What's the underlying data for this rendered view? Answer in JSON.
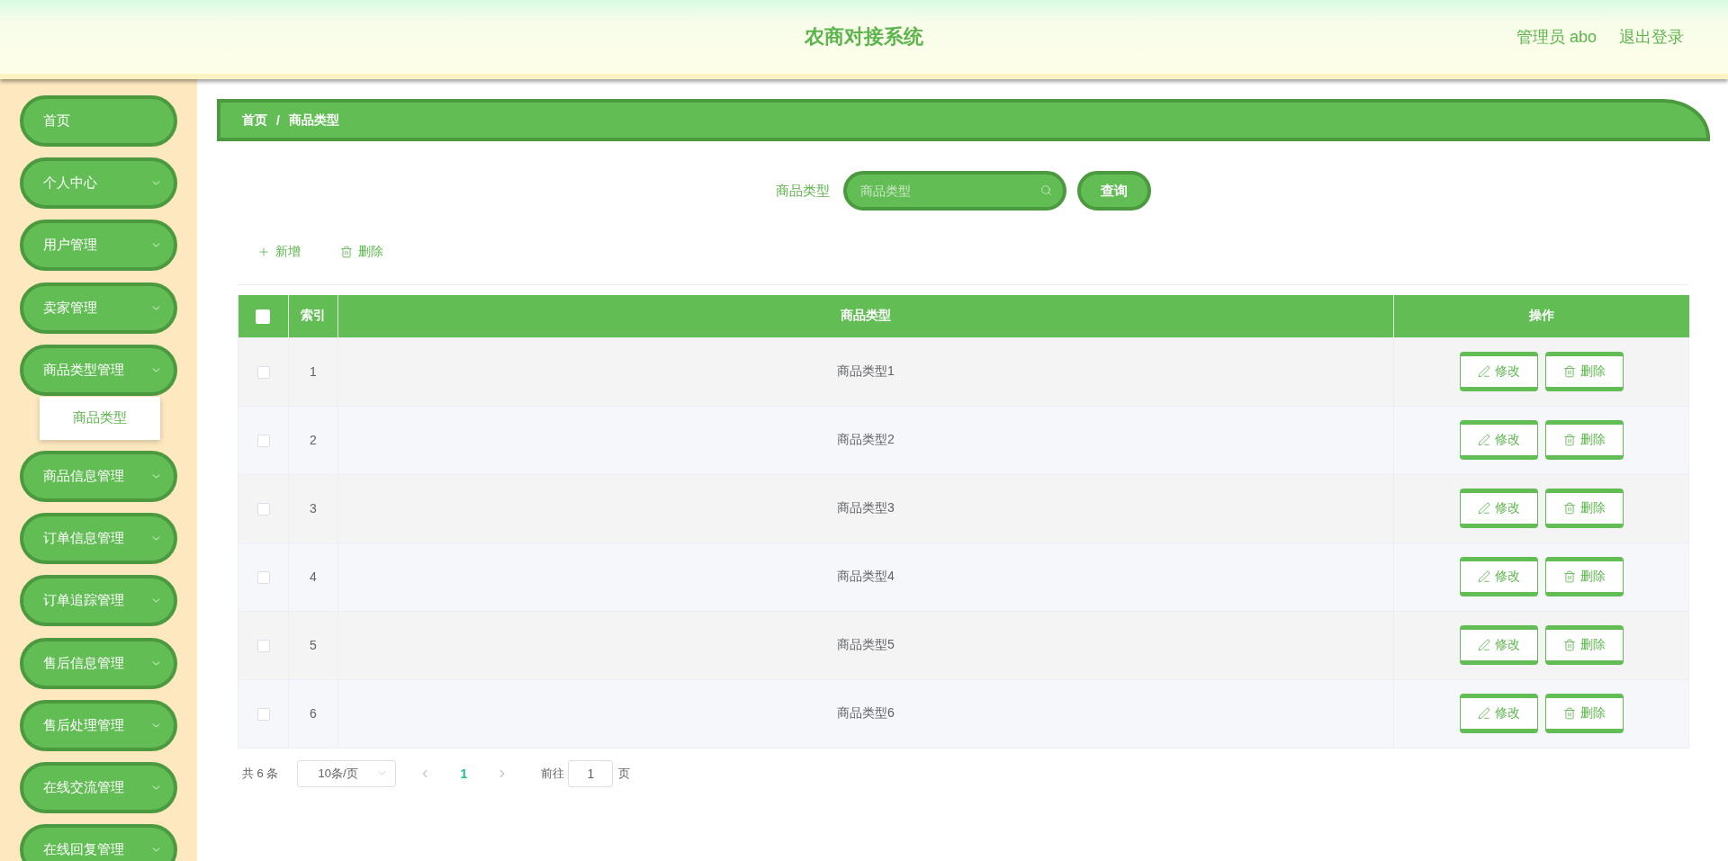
{
  "header": {
    "title": "农商对接系统",
    "user": "管理员 abo",
    "logout": "退出登录"
  },
  "sidebar": {
    "items": [
      {
        "kind": "link",
        "label": "首页"
      },
      {
        "kind": "submenu",
        "label": "个人中心"
      },
      {
        "kind": "submenu",
        "label": "用户管理"
      },
      {
        "kind": "submenu",
        "label": "卖家管理"
      },
      {
        "kind": "submenu",
        "label": "商品类型管理",
        "children": [
          {
            "label": "商品类型"
          }
        ]
      },
      {
        "kind": "submenu",
        "label": "商品信息管理"
      },
      {
        "kind": "submenu",
        "label": "订单信息管理"
      },
      {
        "kind": "submenu",
        "label": "订单追踪管理"
      },
      {
        "kind": "submenu",
        "label": "售后信息管理"
      },
      {
        "kind": "submenu",
        "label": "售后处理管理"
      },
      {
        "kind": "submenu",
        "label": "在线交流管理"
      },
      {
        "kind": "submenu",
        "label": "在线回复管理"
      }
    ]
  },
  "breadcrumb": {
    "items": [
      "首页",
      "商品类型"
    ],
    "separator": "/"
  },
  "search": {
    "label": "商品类型",
    "placeholder": "商品类型",
    "button": "查询"
  },
  "toolbar": [
    {
      "kind": "add",
      "label": "新增"
    },
    {
      "kind": "delete",
      "label": "删除"
    }
  ],
  "table": {
    "select_all": {
      "checked": false
    },
    "columns": [
      "索引",
      "商品类型",
      "操作"
    ],
    "rows": [
      {
        "checked": false,
        "index": "1",
        "name": "商品类型1",
        "actions": [
          {
            "kind": "edit",
            "label": "修改"
          },
          {
            "kind": "delete",
            "label": "删除"
          }
        ]
      },
      {
        "checked": false,
        "index": "2",
        "name": "商品类型2",
        "actions": [
          {
            "kind": "edit",
            "label": "修改"
          },
          {
            "kind": "delete",
            "label": "删除"
          }
        ]
      },
      {
        "checked": false,
        "index": "3",
        "name": "商品类型3",
        "actions": [
          {
            "kind": "edit",
            "label": "修改"
          },
          {
            "kind": "delete",
            "label": "删除"
          }
        ]
      },
      {
        "checked": false,
        "index": "4",
        "name": "商品类型4",
        "actions": [
          {
            "kind": "edit",
            "label": "修改"
          },
          {
            "kind": "delete",
            "label": "删除"
          }
        ]
      },
      {
        "checked": false,
        "index": "5",
        "name": "商品类型5",
        "actions": [
          {
            "kind": "edit",
            "label": "修改"
          },
          {
            "kind": "delete",
            "label": "删除"
          }
        ]
      },
      {
        "checked": false,
        "index": "6",
        "name": "商品类型6",
        "actions": [
          {
            "kind": "edit",
            "label": "修改"
          },
          {
            "kind": "delete",
            "label": "删除"
          }
        ]
      }
    ]
  },
  "pagination": {
    "total": "共 6 条",
    "page_size": "10条/页",
    "prev": {
      "disabled": true
    },
    "pages": [
      {
        "label": "1",
        "selected": true
      }
    ],
    "next": {
      "disabled": true
    },
    "jump_label": "前往",
    "jump_value": "1",
    "jump_suffix": "页"
  }
}
